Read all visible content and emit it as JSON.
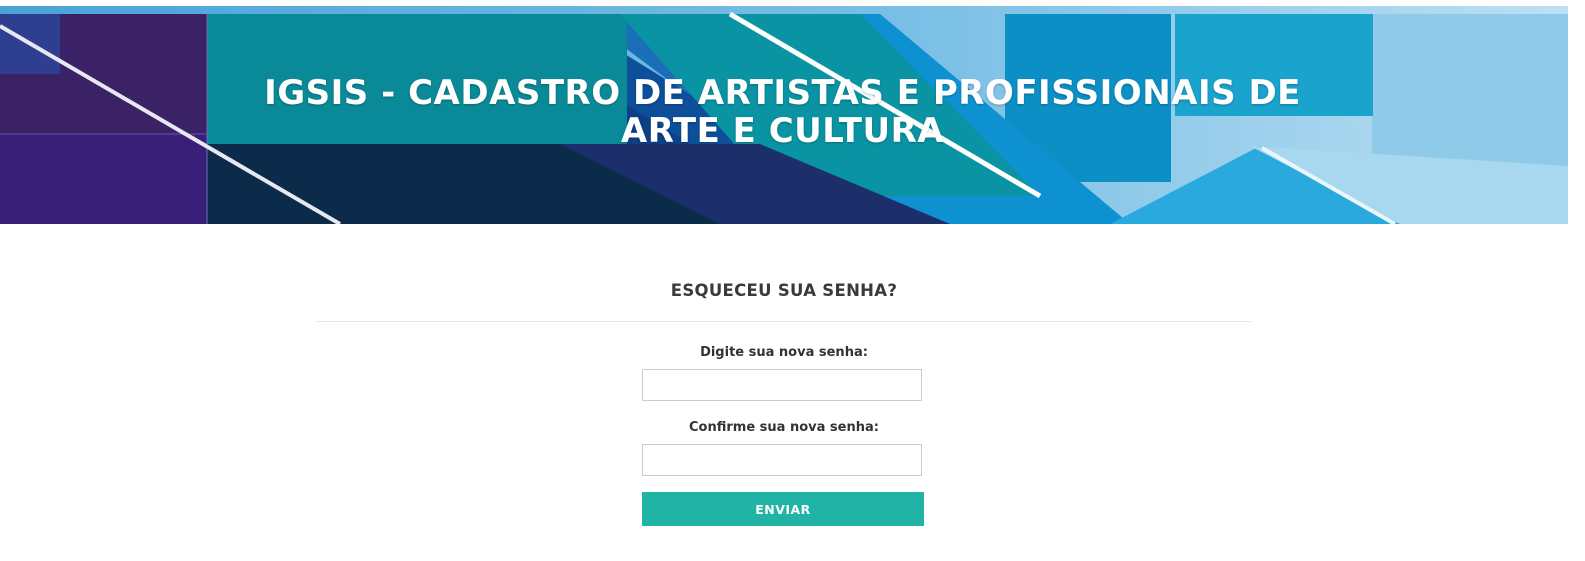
{
  "banner": {
    "title": "IGSIS - CADASTRO DE ARTISTAS E PROFISSIONAIS DE ARTE E CULTURA"
  },
  "form": {
    "title": "ESQUECEU SUA SENHA?",
    "new_password_label": "Digite sua nova senha:",
    "new_password_value": "",
    "confirm_password_label": "Confirme sua nova senha:",
    "confirm_password_value": "",
    "submit_label": "ENVIAR"
  },
  "colors": {
    "accent": "#21b3a6",
    "title_text": "#3a3a3a",
    "banner_text": "#ffffff"
  }
}
